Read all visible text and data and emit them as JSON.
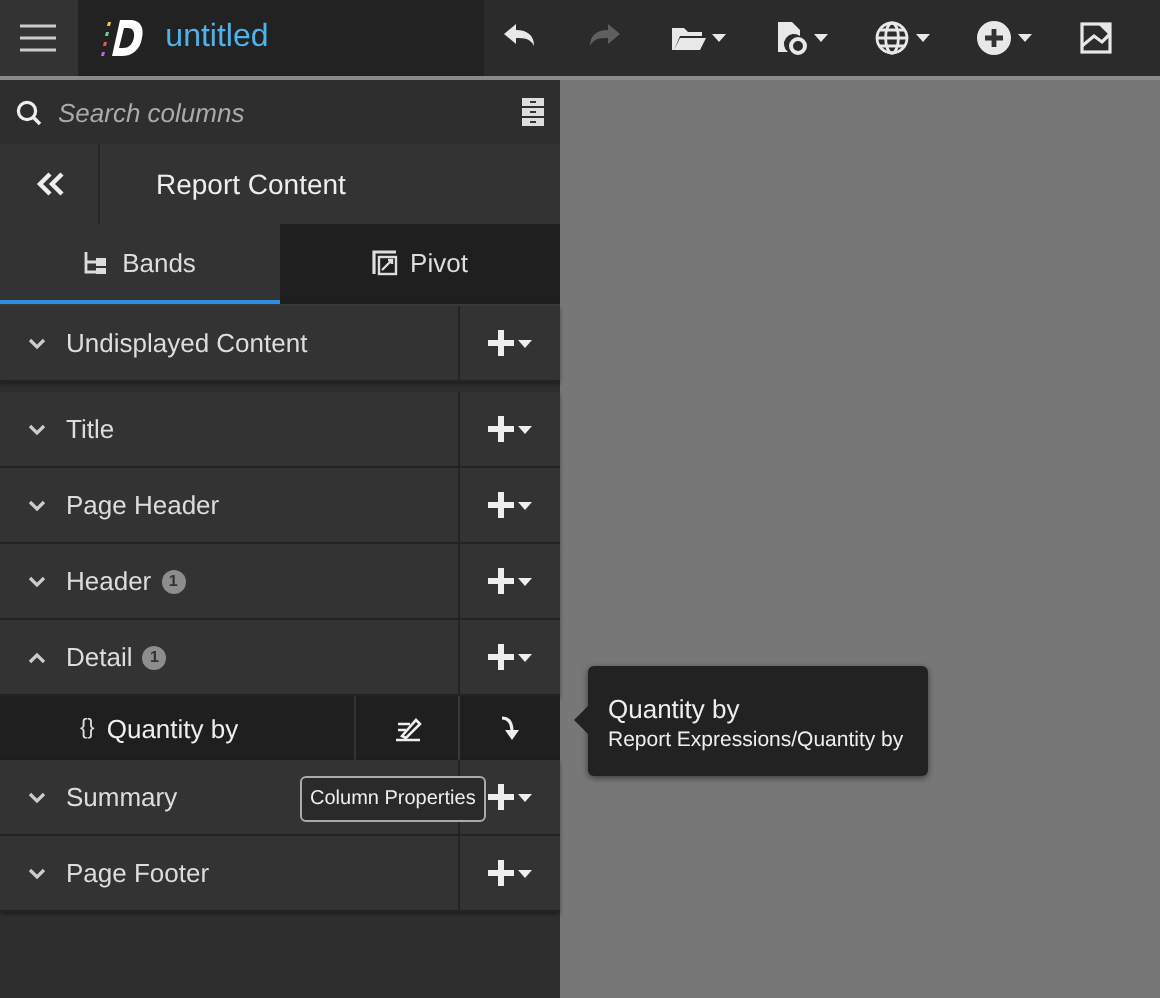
{
  "app": {
    "title": "untitled"
  },
  "toolbar": [
    {
      "kind": "undo",
      "disabled": false,
      "menu": false
    },
    {
      "kind": "redo",
      "disabled": true,
      "menu": false
    },
    {
      "kind": "folder",
      "disabled": false,
      "menu": true
    },
    {
      "kind": "file-gear",
      "disabled": false,
      "menu": true
    },
    {
      "kind": "globe",
      "disabled": false,
      "menu": true
    },
    {
      "kind": "add",
      "disabled": false,
      "menu": true
    },
    {
      "kind": "image",
      "disabled": false,
      "menu": false
    }
  ],
  "search": {
    "placeholder": "Search columns"
  },
  "panel": {
    "title": "Report Content"
  },
  "tabs": [
    {
      "label": "Bands",
      "kind": "bands",
      "selected": true
    },
    {
      "label": "Pivot",
      "kind": "pivot",
      "selected": false
    }
  ],
  "bands": [
    {
      "label": "Undisplayed Content",
      "expanded": false
    },
    {
      "label": "Title",
      "expanded": false
    },
    {
      "label": "Page Header",
      "expanded": false
    },
    {
      "label": "Header",
      "badge": "1",
      "expanded": false
    },
    {
      "label": "Detail",
      "badge": "1",
      "expanded": true,
      "children": [
        {
          "icon": "{}",
          "label": "Quantity by"
        }
      ]
    },
    {
      "label": "Summary",
      "expanded": false
    },
    {
      "label": "Page Footer",
      "expanded": false
    }
  ],
  "tooltip": {
    "title": "Quantity by",
    "path": "Report Expressions/Quantity by"
  },
  "hint": {
    "text": "Column Properties"
  }
}
